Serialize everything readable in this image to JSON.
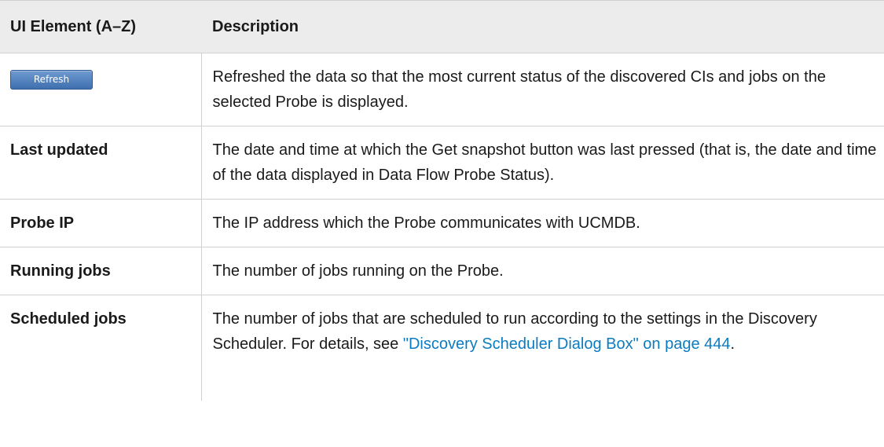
{
  "table": {
    "header": {
      "col1": "UI Element (A–Z)",
      "col2": "Description"
    },
    "rows": [
      {
        "element": {
          "type": "button",
          "label": "Refresh"
        },
        "description": "Refreshed the data so that the most current status of the discovered CIs and jobs on the selected Probe is displayed."
      },
      {
        "element": {
          "type": "text",
          "label": "Last updated"
        },
        "description": "The date and time at which the Get snapshot button was last pressed (that is, the date and time of the data displayed in Data Flow Probe Status)."
      },
      {
        "element": {
          "type": "text",
          "label": "Probe IP"
        },
        "description": "The IP address which the Probe communicates with UCMDB."
      },
      {
        "element": {
          "type": "text",
          "label": "Running jobs"
        },
        "description": "The number of jobs running on the Probe."
      },
      {
        "element": {
          "type": "text",
          "label": "Scheduled jobs"
        },
        "description_before": "The number of jobs that are scheduled to run according to the settings in the Discovery Scheduler. For details, see ",
        "link_text": "\"Discovery Scheduler Dialog Box\" on page 444",
        "description_after": "."
      }
    ]
  },
  "colors": {
    "header_bg": "#ececec",
    "link": "#0b7cc0",
    "button": "#4f7fbe"
  }
}
